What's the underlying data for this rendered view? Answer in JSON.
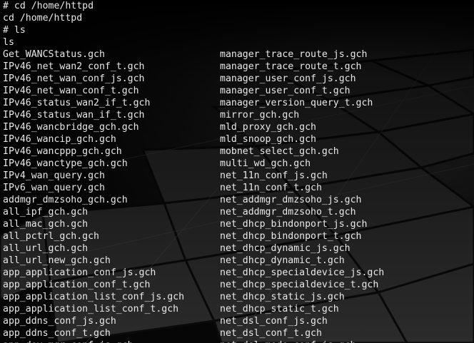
{
  "terminal": {
    "commands": [
      "# cd /home/httpd",
      "cd /home/httpd",
      "# ls",
      "ls"
    ],
    "listing": {
      "left": [
        "Get_WANCStatus.gch",
        "IPv46_net_wan2_conf_t.gch",
        "IPv46_net_wan_conf_js.gch",
        "IPv46_net_wan_conf_t.gch",
        "IPv46_status_wan2_if_t.gch",
        "IPv46_status_wan_if_t.gch",
        "IPv46_wancbridge_gch.gch",
        "IPv46_wancip_gch.gch",
        "IPv46_wancppp_gch.gch",
        "IPv46_wanctype_gch.gch",
        "IPv4_wan_query.gch",
        "IPv6_wan_query.gch",
        "addmgr_dmzsoho_gch.gch",
        "all_ipf_gch.gch",
        "all_mac_gch.gch",
        "all_pctrl_gch.gch",
        "all_url_gch.gch",
        "all_url_new_gch.gch",
        "app_application_conf_js.gch",
        "app_application_conf_t.gch",
        "app_application_list_conf_js.gch",
        "app_application_list_conf_t.gch",
        "app_ddns_conf_js.gch",
        "app_ddns_conf_t.gch",
        "app_dev_mgr_conf_js.gch"
      ],
      "right": [
        "manager_trace_route_js.gch",
        "manager_trace_route_t.gch",
        "manager_user_conf_js.gch",
        "manager_user_conf_t.gch",
        "manager_version_query_t.gch",
        "mirror_gch.gch",
        "mld_proxy_gch.gch",
        "mld_snoop_gch.gch",
        "mobnet_select_gch.gch",
        "multi_wd_gch.gch",
        "net_11n_conf_js.gch",
        "net_11n_conf_t.gch",
        "net_addmgr_dmzsoho_js.gch",
        "net_addmgr_dmzsoho_t.gch",
        "net_dhcp_bindonport_js.gch",
        "net_dhcp_bindonport_t.gch",
        "net_dhcp_dynamic_js.gch",
        "net_dhcp_dynamic_t.gch",
        "net_dhcp_specialdevice_js.gch",
        "net_dhcp_specialdevice_t.gch",
        "net_dhcp_static_js.gch",
        "net_dhcp_static_t.gch",
        "net_dsl_conf_js.gch",
        "net_dsl_conf_t.gch",
        "net_dsl_mode_conf_js.gch"
      ]
    },
    "colors": {
      "text": "#e8e8e8",
      "background": "#050505"
    }
  }
}
